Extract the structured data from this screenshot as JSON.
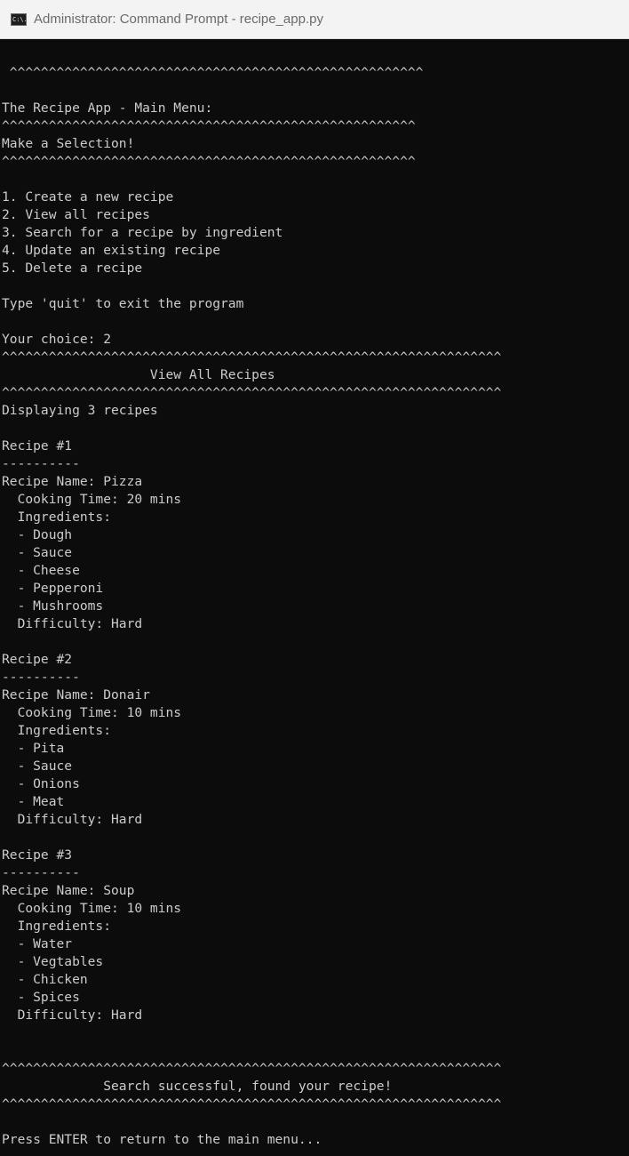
{
  "window": {
    "title": "Administrator: Command Prompt - recipe_app.py",
    "icon": "cmd-icon",
    "icon_label": "C:\\."
  },
  "console": {
    "lines": [
      "",
      " ^^^^^^^^^^^^^^^^^^^^^^^^^^^^^^^^^^^^^^^^^^^^^^^^^^^^^",
      "",
      "The Recipe App - Main Menu:",
      "^^^^^^^^^^^^^^^^^^^^^^^^^^^^^^^^^^^^^^^^^^^^^^^^^^^^^",
      "Make a Selection!",
      "^^^^^^^^^^^^^^^^^^^^^^^^^^^^^^^^^^^^^^^^^^^^^^^^^^^^^",
      "",
      "1. Create a new recipe",
      "2. View all recipes",
      "3. Search for a recipe by ingredient",
      "4. Update an existing recipe",
      "5. Delete a recipe",
      "",
      "Type 'quit' to exit the program",
      "",
      "Your choice: 2",
      "^^^^^^^^^^^^^^^^^^^^^^^^^^^^^^^^^^^^^^^^^^^^^^^^^^^^^^^^^^^^^^^^",
      "                   View All Recipes",
      "^^^^^^^^^^^^^^^^^^^^^^^^^^^^^^^^^^^^^^^^^^^^^^^^^^^^^^^^^^^^^^^^",
      "Displaying 3 recipes",
      "",
      "Recipe #1",
      "----------",
      "Recipe Name: Pizza",
      "  Cooking Time: 20 mins",
      "  Ingredients:",
      "  - Dough",
      "  - Sauce",
      "  - Cheese",
      "  - Pepperoni",
      "  - Mushrooms",
      "  Difficulty: Hard",
      "",
      "Recipe #2",
      "----------",
      "Recipe Name: Donair",
      "  Cooking Time: 10 mins",
      "  Ingredients:",
      "  - Pita",
      "  - Sauce",
      "  - Onions",
      "  - Meat",
      "  Difficulty: Hard",
      "",
      "Recipe #3",
      "----------",
      "Recipe Name: Soup",
      "  Cooking Time: 10 mins",
      "  Ingredients:",
      "  - Water",
      "  - Vegtables",
      "  - Chicken",
      "  - Spices",
      "  Difficulty: Hard",
      "",
      "",
      "^^^^^^^^^^^^^^^^^^^^^^^^^^^^^^^^^^^^^^^^^^^^^^^^^^^^^^^^^^^^^^^^",
      "             Search successful, found your recipe!",
      "^^^^^^^^^^^^^^^^^^^^^^^^^^^^^^^^^^^^^^^^^^^^^^^^^^^^^^^^^^^^^^^^",
      "",
      "Press ENTER to return to the main menu..."
    ]
  },
  "colors": {
    "console_background": "#0c0c0c",
    "console_text": "#cccccc",
    "titlebar_background": "#f3f3f3",
    "title_text": "#6b6b6b"
  }
}
